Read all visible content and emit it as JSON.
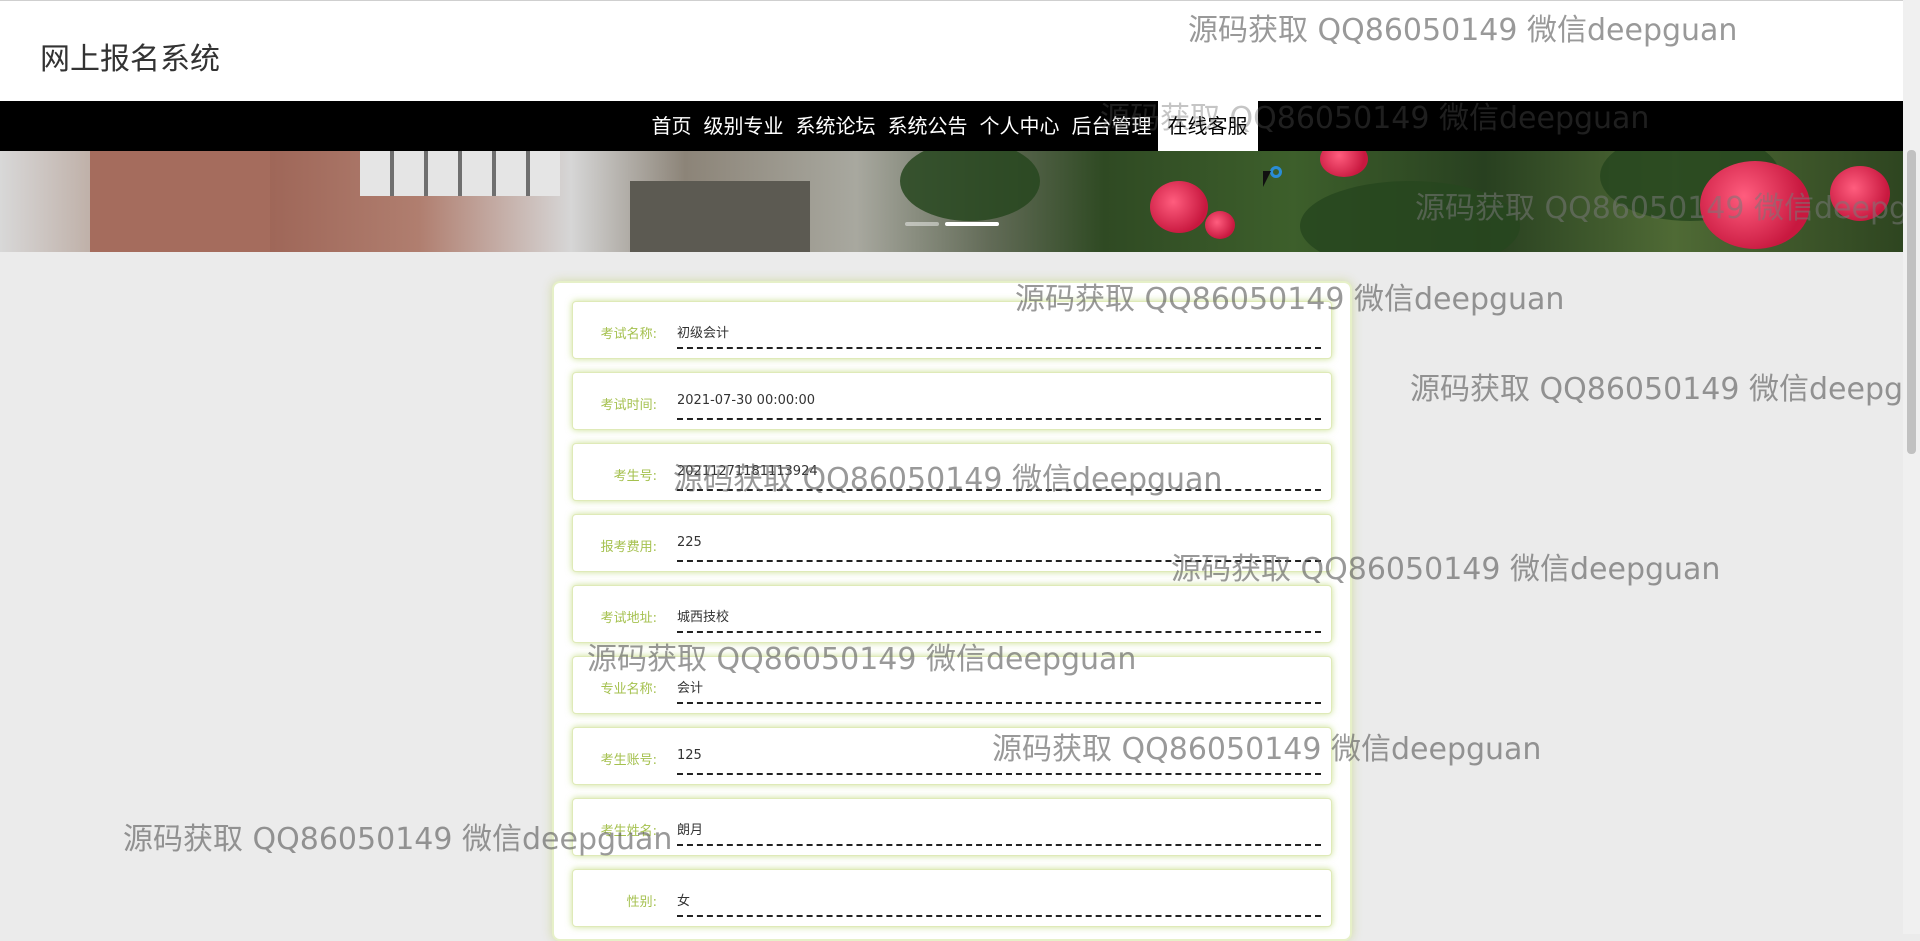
{
  "header": {
    "site_title": "网上报名系统"
  },
  "nav": {
    "items": [
      {
        "label": "首页"
      },
      {
        "label": "级别专业"
      },
      {
        "label": "系统论坛"
      },
      {
        "label": "系统公告"
      },
      {
        "label": "个人中心"
      },
      {
        "label": "后台管理"
      },
      {
        "label": "在线客服",
        "active": true
      }
    ]
  },
  "form": {
    "fields": [
      {
        "label": "考试名称:",
        "value": "初级会计"
      },
      {
        "label": "考试时间:",
        "value": "2021-07-30 00:00:00"
      },
      {
        "label": "考生号:",
        "value": "20211271181113924"
      },
      {
        "label": "报考费用:",
        "value": "225"
      },
      {
        "label": "考试地址:",
        "value": "城西技校"
      },
      {
        "label": "专业名称:",
        "value": "会计"
      },
      {
        "label": "考生账号:",
        "value": "125"
      },
      {
        "label": "考生姓名:",
        "value": "朗月"
      },
      {
        "label": "性别:",
        "value": "女"
      }
    ]
  },
  "watermark": {
    "text": "源码获取 QQ86050149 微信deepguan"
  },
  "colors": {
    "label_green": "#a5c14f",
    "nav_bg": "#000000",
    "page_bg": "#ebebeb",
    "card_glow": "#dfeab8"
  }
}
